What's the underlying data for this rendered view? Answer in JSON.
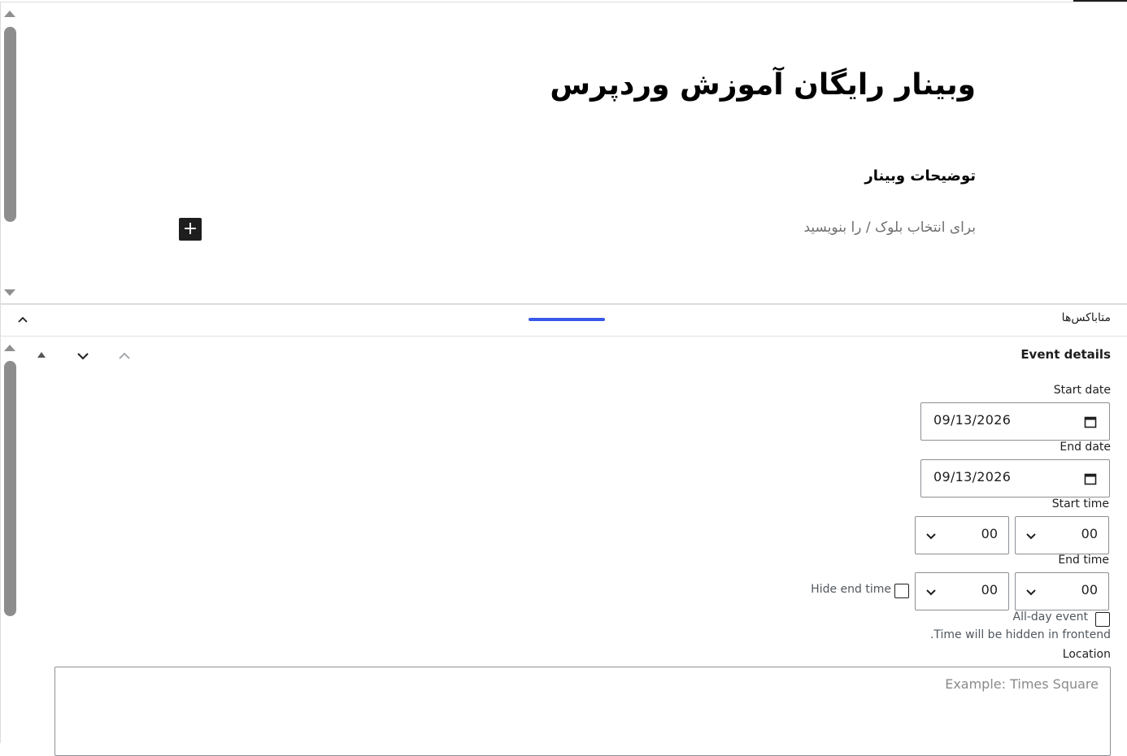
{
  "editor": {
    "post_title": "وبینار رایگان آموزش وردپرس",
    "heading": "توضیحات وبینار",
    "paragraph_placeholder": "برای انتخاب بلوک / را بنویسید",
    "inserter_label": "+"
  },
  "metaboxes": {
    "title": "متاباکس‌ها"
  },
  "event_details": {
    "title": "Event details",
    "start_date_label": "Start date",
    "start_date_value": "09/13/2026",
    "end_date_label": "End date",
    "end_date_value": "09/13/2026",
    "start_time_label": "Start time",
    "start_hour": "00",
    "start_minute": "00",
    "end_time_label": "End time",
    "end_hour": "00",
    "end_minute": "00",
    "hide_end_time_label": "Hide end time",
    "all_day_label": "All-day event",
    "time_hidden_note": ".Time will be hidden in frontend",
    "location_label": "Location",
    "location_placeholder": "Example: Times Square"
  },
  "colors": {
    "accent": "#3858e9",
    "inserter": "#1e1e1e",
    "scrollbar": "#8d8d8d"
  }
}
